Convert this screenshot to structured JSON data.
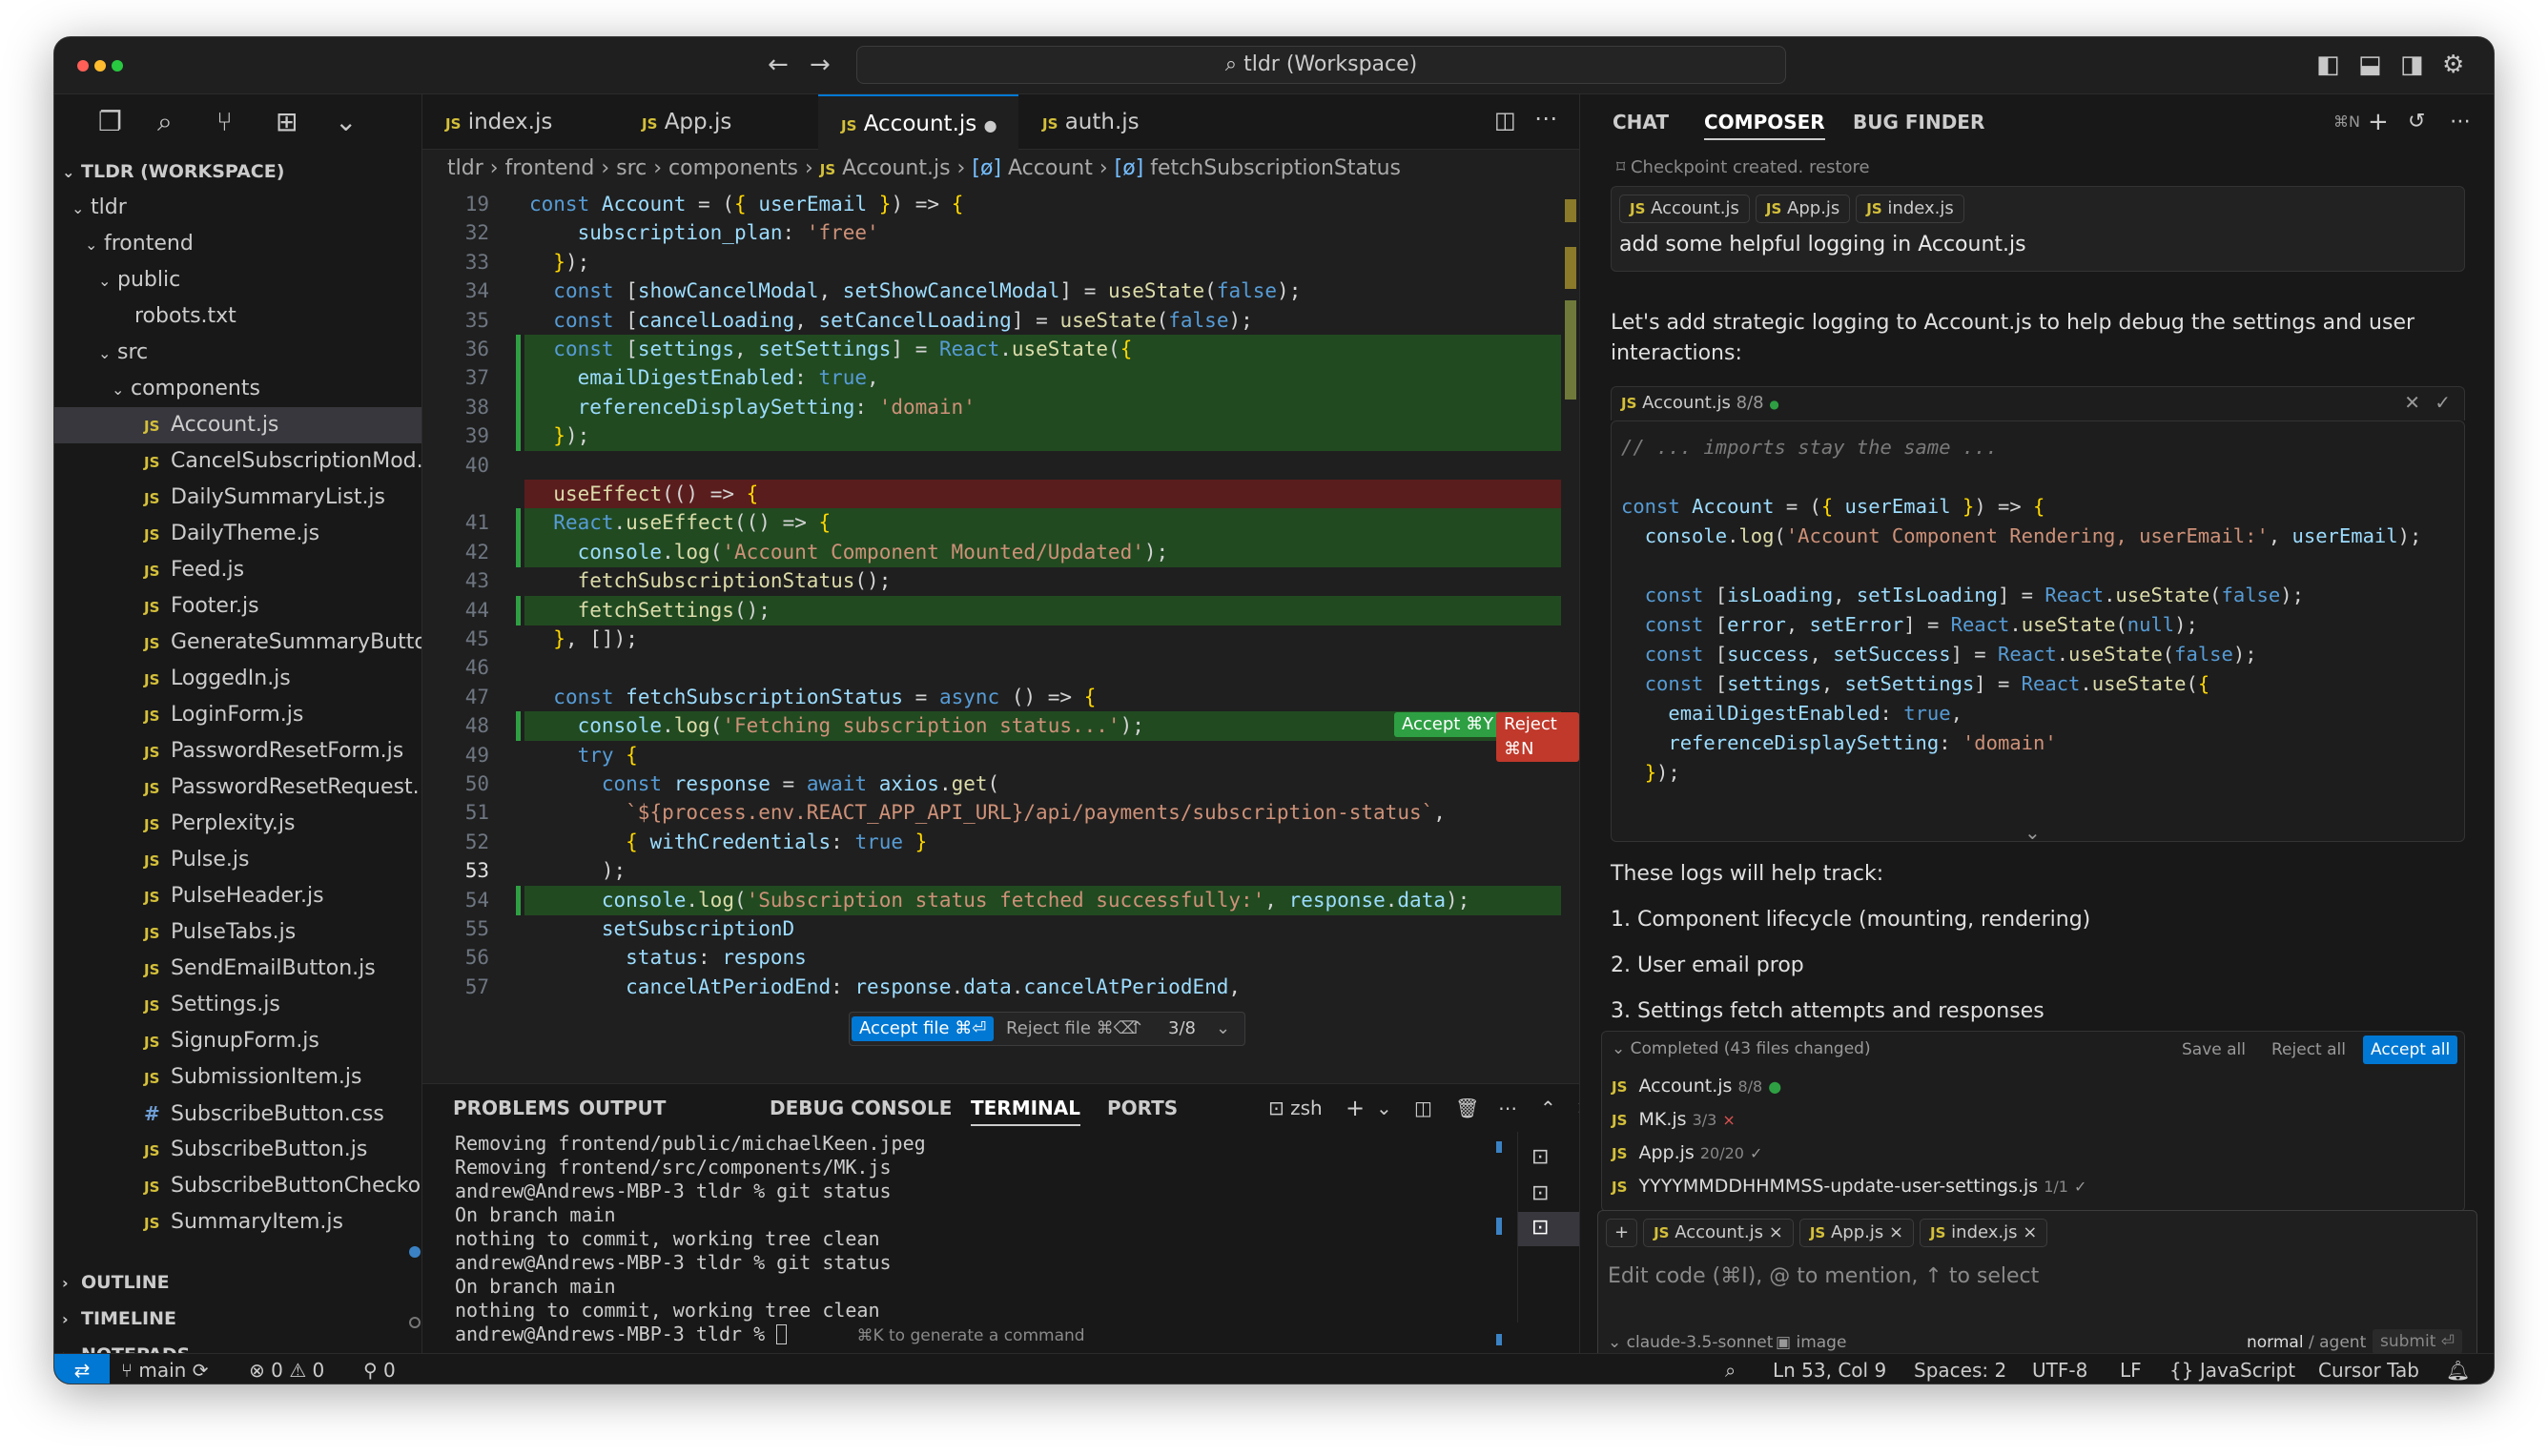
{
  "window": {
    "title": "tldr (Workspace)",
    "accent": "#0078d4"
  },
  "sidebar": {
    "workspace": "TLDR (WORKSPACE)",
    "tree": [
      {
        "label": "tldr",
        "kind": "folder",
        "depth": 0
      },
      {
        "label": "frontend",
        "kind": "folder",
        "depth": 1
      },
      {
        "label": "public",
        "kind": "folder",
        "depth": 2
      },
      {
        "label": "robots.txt",
        "kind": "file",
        "depth": 3
      },
      {
        "label": "src",
        "kind": "folder",
        "depth": 2
      },
      {
        "label": "components",
        "kind": "folder",
        "depth": 3
      },
      {
        "label": "Account.js",
        "kind": "js",
        "depth": 4,
        "selected": true
      },
      {
        "label": "CancelSubscriptionMod...",
        "kind": "js",
        "depth": 4
      },
      {
        "label": "DailySummaryList.js",
        "kind": "js",
        "depth": 4
      },
      {
        "label": "DailyTheme.js",
        "kind": "js",
        "depth": 4
      },
      {
        "label": "Feed.js",
        "kind": "js",
        "depth": 4
      },
      {
        "label": "Footer.js",
        "kind": "js",
        "depth": 4
      },
      {
        "label": "GenerateSummaryButto...",
        "kind": "js",
        "depth": 4
      },
      {
        "label": "LoggedIn.js",
        "kind": "js",
        "depth": 4
      },
      {
        "label": "LoginForm.js",
        "kind": "js",
        "depth": 4
      },
      {
        "label": "PasswordResetForm.js",
        "kind": "js",
        "depth": 4
      },
      {
        "label": "PasswordResetRequest...",
        "kind": "js",
        "depth": 4
      },
      {
        "label": "Perplexity.js",
        "kind": "js",
        "depth": 4
      },
      {
        "label": "Pulse.js",
        "kind": "js",
        "depth": 4
      },
      {
        "label": "PulseHeader.js",
        "kind": "js",
        "depth": 4
      },
      {
        "label": "PulseTabs.js",
        "kind": "js",
        "depth": 4
      },
      {
        "label": "SendEmailButton.js",
        "kind": "js",
        "depth": 4
      },
      {
        "label": "Settings.js",
        "kind": "js",
        "depth": 4
      },
      {
        "label": "SignupForm.js",
        "kind": "js",
        "depth": 4
      },
      {
        "label": "SubmissionItem.js",
        "kind": "js",
        "depth": 4
      },
      {
        "label": "SubscribeButton.css",
        "kind": "css",
        "depth": 4
      },
      {
        "label": "SubscribeButton.js",
        "kind": "js",
        "depth": 4
      },
      {
        "label": "SubscribeButtonChecko...",
        "kind": "js",
        "depth": 4
      },
      {
        "label": "SummaryItem.js",
        "kind": "js",
        "depth": 4
      }
    ],
    "sections": [
      "OUTLINE",
      "TIMELINE",
      "NOTEPADS"
    ]
  },
  "editor": {
    "tabs": [
      {
        "label": "index.js",
        "active": false
      },
      {
        "label": "App.js",
        "active": false
      },
      {
        "label": "Account.js",
        "active": true,
        "dirty": true
      },
      {
        "label": "auth.js",
        "active": false
      }
    ],
    "breadcrumb": [
      "tldr",
      "frontend",
      "src",
      "components",
      "Account.js",
      "Account",
      "fetchSubscriptionStatus"
    ],
    "lines": [
      {
        "n": "19",
        "t": "const Account = ({ userEmail }) => {",
        "kind": "sticky"
      },
      {
        "n": "32",
        "t": "    subscription_plan: 'free'",
        "kind": ""
      },
      {
        "n": "33",
        "t": "  });",
        "kind": ""
      },
      {
        "n": "34",
        "t": "  const [showCancelModal, setShowCancelModal] = useState(false);",
        "kind": ""
      },
      {
        "n": "35",
        "t": "  const [cancelLoading, setCancelLoading] = useState(false);",
        "kind": ""
      },
      {
        "n": "36",
        "t": "  const [settings, setSettings] = React.useState({",
        "kind": "add"
      },
      {
        "n": "37",
        "t": "    emailDigestEnabled: true,",
        "kind": "add"
      },
      {
        "n": "38",
        "t": "    referenceDisplaySetting: 'domain'",
        "kind": "add"
      },
      {
        "n": "39",
        "t": "  });",
        "kind": "add"
      },
      {
        "n": "40",
        "t": "",
        "kind": ""
      },
      {
        "n": "",
        "t": "  useEffect(() => {",
        "kind": "del"
      },
      {
        "n": "41",
        "t": "  React.useEffect(() => {",
        "kind": "add"
      },
      {
        "n": "42",
        "t": "    console.log('Account Component Mounted/Updated');",
        "kind": "add"
      },
      {
        "n": "43",
        "t": "    fetchSubscriptionStatus();",
        "kind": ""
      },
      {
        "n": "44",
        "t": "    fetchSettings();",
        "kind": "add"
      },
      {
        "n": "45",
        "t": "  }, []);",
        "kind": ""
      },
      {
        "n": "46",
        "t": "",
        "kind": ""
      },
      {
        "n": "47",
        "t": "  const fetchSubscriptionStatus = async () => {",
        "kind": ""
      },
      {
        "n": "48",
        "t": "    console.log('Fetching subscription status...');",
        "kind": "add"
      },
      {
        "n": "49",
        "t": "    try {",
        "kind": ""
      },
      {
        "n": "50",
        "t": "      const response = await axios.get(",
        "kind": ""
      },
      {
        "n": "51",
        "t": "        `${process.env.REACT_APP_API_URL}/api/payments/subscription-status`,",
        "kind": ""
      },
      {
        "n": "52",
        "t": "        { withCredentials: true }",
        "kind": ""
      },
      {
        "n": "53",
        "t": "      );",
        "kind": ""
      },
      {
        "n": "54",
        "t": "      console.log('Subscription status fetched successfully:', response.data);",
        "kind": "add"
      },
      {
        "n": "55",
        "t": "      setSubscriptionD",
        "kind": ""
      },
      {
        "n": "56",
        "t": "        status: respons",
        "kind": ""
      },
      {
        "n": "57",
        "t": "        cancelAtPeriodEnd: response.data.cancelAtPeriodEnd,",
        "kind": ""
      }
    ],
    "inline_accept": "Accept ⌘Y",
    "inline_reject": "Reject ⌘N",
    "accept_file": "Accept file ⌘⏎",
    "reject_file": "Reject file ⌘⌫",
    "hunk_counter": "3/8"
  },
  "panel": {
    "tabs": [
      "PROBLEMS",
      "OUTPUT",
      "DEBUG CONSOLE",
      "TERMINAL",
      "PORTS"
    ],
    "active_tab": "TERMINAL",
    "shell": "zsh",
    "terminal": "Removing frontend/public/michaelKeen.jpeg\nRemoving frontend/src/components/MK.js\nandrew@Andrews-MBP-3 tldr % git status\nOn branch main\nnothing to commit, working tree clean\nandrew@Andrews-MBP-3 tldr % git status\nOn branch main\nnothing to commit, working tree clean\nandrew@Andrews-MBP-3 tldr % ",
    "hint": "⌘K to generate a command"
  },
  "composer": {
    "tabs": [
      "CHAT",
      "COMPOSER",
      "BUG FINDER"
    ],
    "active_tab": "COMPOSER",
    "shortcut": "⌘N",
    "checkpoint": "Checkpoint created. restore",
    "context_chips": [
      "Account.js",
      "App.js",
      "index.js"
    ],
    "user_message": "add some helpful logging in Account.js",
    "intro": "Let's add strategic logging to Account.js to help debug the settings and user interactions:",
    "code_file": "Account.js",
    "code_count": "8/8",
    "code": [
      "// ... imports stay the same ...",
      "",
      "const Account = ({ userEmail }) => {",
      "  console.log('Account Component Rendering, userEmail:', userEmail);",
      "",
      "  const [isLoading, setIsLoading] = React.useState(false);",
      "  const [error, setError] = React.useState(null);",
      "  const [success, setSuccess] = React.useState(false);",
      "  const [settings, setSettings] = React.useState({",
      "    emailDigestEnabled: true,",
      "    referenceDisplaySetting: 'domain'",
      "  });"
    ],
    "track_intro": "These logs will help track:",
    "track_items": [
      "1. Component lifecycle (mounting, rendering)",
      "2. User email prop",
      "3. Settings fetch attempts and responses"
    ],
    "completed": "Completed (43 files changed)",
    "save_all": "Save all",
    "reject_all": "Reject all",
    "accept_all": "Accept all",
    "changed_files": [
      {
        "name": "Account.js",
        "count": "8/8",
        "mark": "●"
      },
      {
        "name": "MK.js",
        "count": "3/3",
        "mark": "×"
      },
      {
        "name": "App.js",
        "count": "20/20",
        "mark": "✓"
      },
      {
        "name": "YYYYMMDDHHMMSS-update-user-settings.js",
        "count": "1/1",
        "mark": "✓"
      }
    ],
    "input_chips": [
      "Account.js",
      "App.js",
      "index.js"
    ],
    "input_placeholder": "Edit code (⌘I), @ to mention, ↑ to select",
    "model": "claude-3.5-sonnet",
    "image_label": "image",
    "mode_normal": "normal",
    "mode_sep": "/",
    "mode_agent": "agent",
    "submit": "submit ⏎"
  },
  "statusbar": {
    "branch": "main",
    "errors": "0",
    "warnings": "0",
    "ports": "0",
    "position": "Ln 53, Col 9",
    "spaces": "Spaces: 2",
    "encoding": "UTF-8",
    "eol": "LF",
    "language": "JavaScript",
    "cursor_tab": "Cursor Tab"
  }
}
